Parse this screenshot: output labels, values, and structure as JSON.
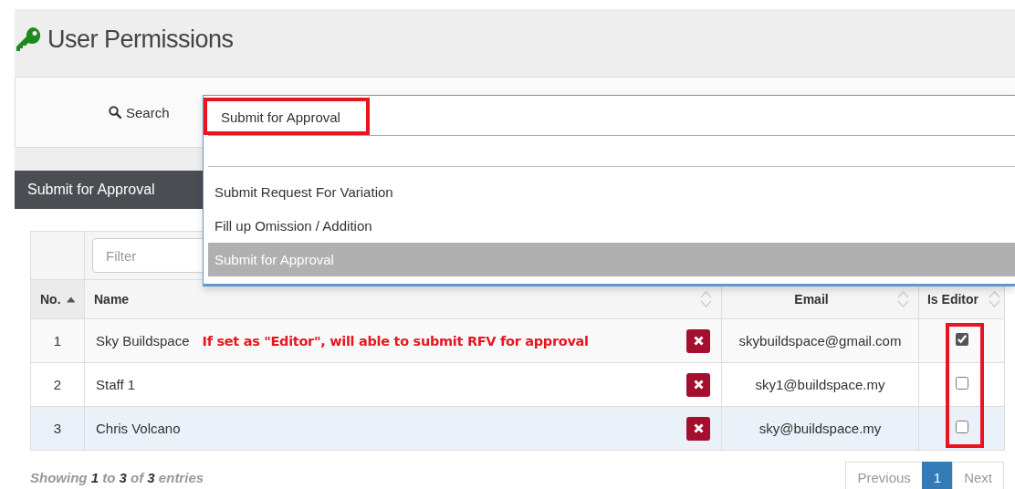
{
  "page": {
    "title": "User Permissions"
  },
  "search": {
    "label": "Search",
    "value": "Submit for Approval",
    "value_highlighted": true,
    "expanded": true,
    "options": [
      {
        "label": "Submit Request For Variation",
        "selected": false
      },
      {
        "label": "Fill up Omission / Addition",
        "selected": false
      },
      {
        "label": "Submit for Approval",
        "selected": true
      }
    ]
  },
  "section": {
    "title": "Submit for Approval"
  },
  "table": {
    "filter_placeholder": "Filter",
    "editor_column_highlighted": true,
    "columns": [
      {
        "label": "No.",
        "sorted": true
      },
      {
        "label": "Name",
        "sorted": false
      },
      {
        "label": "Email",
        "sorted": false
      },
      {
        "label": "Is Editor",
        "sorted": false
      }
    ],
    "rows": [
      {
        "no": "1",
        "name": "Sky Buildspace",
        "note": "If set as \"Editor\", will able to submit RFV for approval",
        "email": "skybuildspace@gmail.com",
        "is_editor": true,
        "highlighted": false
      },
      {
        "no": "2",
        "name": "Staff 1",
        "email": "sky1@buildspace.my",
        "is_editor": false,
        "highlighted": false
      },
      {
        "no": "3",
        "name": "Chris Volcano",
        "email": "sky@buildspace.my",
        "is_editor": false,
        "highlighted": true
      }
    ]
  },
  "footer": {
    "summary": "Showing **1** to **3** of **3** entries",
    "pages": [
      {
        "label": "Previous",
        "selected": false
      },
      {
        "label": "1",
        "selected": true
      },
      {
        "label": "Next",
        "selected": false
      }
    ]
  }
}
